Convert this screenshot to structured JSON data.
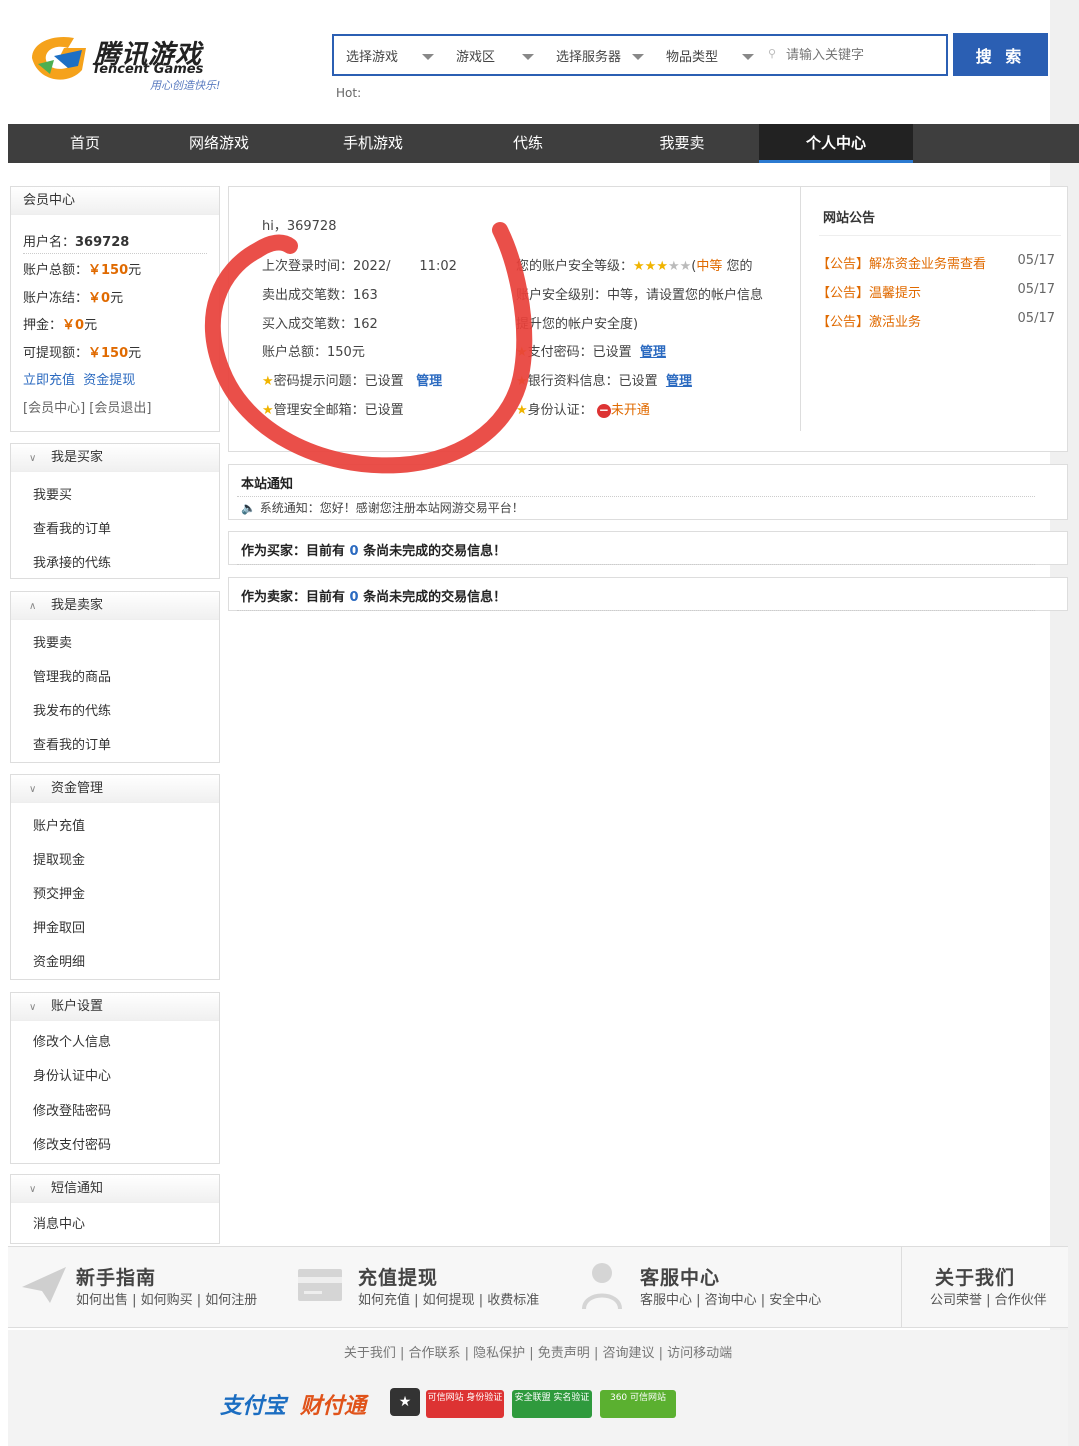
{
  "header": {
    "logo_cn": "腾讯游戏",
    "logo_en": "Tencent Games",
    "logo_slogan": "用心创造快乐!",
    "selects": [
      "选择游戏",
      "游戏区",
      "选择服务器",
      "物品类型"
    ],
    "search_placeholder": "请输入关键字",
    "search_button": "搜 索",
    "hot_label": "Hot:"
  },
  "nav": {
    "items": [
      "首页",
      "网络游戏",
      "手机游戏",
      "代练",
      "我要卖",
      "个人中心"
    ],
    "active_index": 5
  },
  "member": {
    "title": "会员中心",
    "username_label": "用户名：",
    "username": "369728",
    "total_label": "账户总额：",
    "total": "￥150",
    "frozen_label": "账户冻结：",
    "frozen": "￥0",
    "deposit_label": "押金：",
    "deposit": "￥0",
    "withdrawable_label": "可提现额：",
    "withdrawable": "￥150",
    "unit": "元",
    "recharge_link": "立即充值",
    "withdraw_link": "资金提现",
    "center_link": "[会员中心]",
    "logout_link": "[会员退出]"
  },
  "sidebar": {
    "buyer": {
      "title": "我是买家",
      "items": [
        "我要买",
        "查看我的订单",
        "我承接的代练"
      ]
    },
    "seller": {
      "title": "我是卖家",
      "items": [
        "我要卖",
        "管理我的商品",
        "我发布的代练",
        "查看我的订单"
      ]
    },
    "funds": {
      "title": "资金管理",
      "items": [
        "账户充值",
        "提取现金",
        "预交押金",
        "押金取回",
        "资金明细"
      ]
    },
    "account": {
      "title": "账户设置",
      "items": [
        "修改个人信息",
        "身份认证中心",
        "修改登陆密码",
        "修改支付密码"
      ]
    },
    "sms": {
      "title": "短信通知",
      "items": [
        "消息中心"
      ]
    }
  },
  "info": {
    "greeting": "hi，369728",
    "last_login": "上次登录时间：2022/",
    "last_login_tail": "11:02",
    "sold_count": "卖出成交笔数：163",
    "bought_count": "买入成交笔数：162",
    "account_total": "账户总额：150元",
    "pwd_hint": "密码提示问题：已设置",
    "pwd_hint_manage": "管理",
    "safe_email": "管理安全邮箱：已设置",
    "security_level_label": "您的账户安全等级：",
    "security_level_value": "中等",
    "security_desc1": "您的",
    "security_desc2": "账户安全级别：中等，请设置您的帐户信息",
    "security_desc3": "提升您的帐户安全度)",
    "pay_pwd": "支付密码：已设置",
    "pay_pwd_manage": "管理",
    "bank_info": "银行资料信息：已设置",
    "bank_manage": "管理",
    "identity": "身份认证：",
    "identity_status": "未开通",
    "stars_filled": 3,
    "stars_total": 5
  },
  "notices": {
    "title": "网站公告",
    "items": [
      {
        "text": "【公告】解冻资金业务需查看",
        "date": "05/17"
      },
      {
        "text": "【公告】温馨提示",
        "date": "05/17"
      },
      {
        "text": "【公告】激活业务",
        "date": "05/17"
      }
    ]
  },
  "site_notice": {
    "title": "本站通知",
    "text": "系统通知：您好！感谢您注册本站网游交易平台！"
  },
  "buyer_msg": {
    "prefix": "作为买家：目前有",
    "count": "0",
    "suffix": "条尚未完成的交易信息！"
  },
  "seller_msg": {
    "prefix": "作为卖家：目前有",
    "count": "0",
    "suffix": "条尚未完成的交易信息！"
  },
  "footer": {
    "guide": {
      "title": "新手指南",
      "links": "如何出售 | 如何购买 | 如何注册"
    },
    "recharge": {
      "title": "充值提现",
      "links": "如何充值 | 如何提现 | 收费标准"
    },
    "service": {
      "title": "客服中心",
      "links": "客服中心 | 咨询中心 | 安全中心"
    },
    "about": {
      "title": "关于我们",
      "links": "公司荣誉 | 合作伙伴"
    },
    "bottom_links": "关于我们 | 合作联系 | 隐私保护 | 免责声明 | 咨询建议 | 访问移动端",
    "badges": {
      "alipay": "支付宝",
      "tenpay": "财付通",
      "credit": "可信网站 身份验证",
      "safe": "安全联盟 实名验证",
      "v360": "360 可信网站"
    }
  },
  "colors": {
    "accent": "#2b5fb3",
    "nav_bg": "#3e3e3e",
    "money": "#e06a00",
    "annotation": "#e8403a"
  }
}
